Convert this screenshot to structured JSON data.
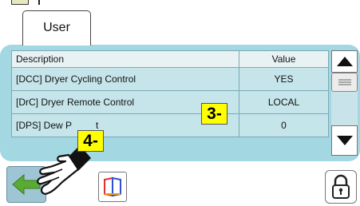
{
  "tab": {
    "label": "User"
  },
  "table": {
    "columns": [
      "Description",
      "Value"
    ],
    "rows": [
      {
        "description": "[DCC] Dryer Cycling Control",
        "value": "YES"
      },
      {
        "description": "[DrC] Dryer Remote Control",
        "value": "LOCAL"
      },
      {
        "description": "[DPS] Dew P",
        "description_tail": "t",
        "value": "0"
      }
    ]
  },
  "callouts": {
    "step3": "3-",
    "step4": "4-"
  },
  "icons": {
    "scroll_up": "triangle-up-icon",
    "scroll_thumb": "grip-lines-icon",
    "scroll_down": "triangle-down-icon",
    "back": "green-back-arrow-icon",
    "map": "colored-frame-icon",
    "lock": "padlock-icon",
    "pointer": "pointing-hand-icon"
  },
  "colors": {
    "panel": "#a3d7e2",
    "row": "#c5e5ea",
    "callout": "#ffff00",
    "back_arrow": "#5aab32"
  }
}
